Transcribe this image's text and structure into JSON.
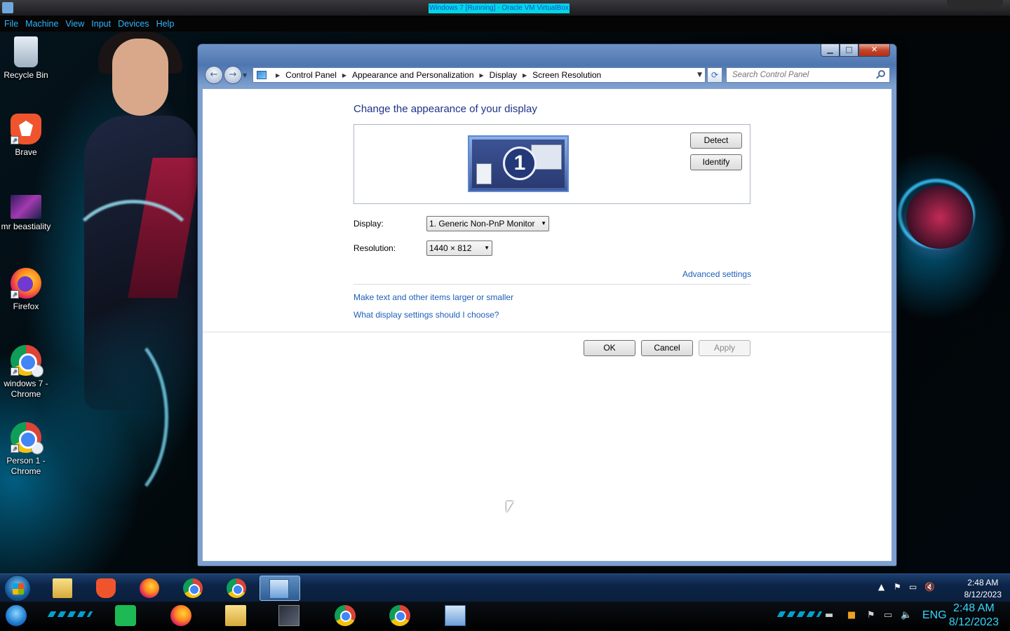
{
  "vbox": {
    "title": "Windows 7 [Running] - Oracle VM VirtualBox",
    "menu": [
      "File",
      "Machine",
      "View",
      "Input",
      "Devices",
      "Help"
    ]
  },
  "desktop_icons": [
    {
      "label": "Recycle Bin",
      "icon": "recycle-bin-icon"
    },
    {
      "label": "Brave",
      "icon": "brave-icon"
    },
    {
      "label": "mr beastiality",
      "icon": "image-file-icon"
    },
    {
      "label": "Firefox",
      "icon": "firefox-icon"
    },
    {
      "label": "windows 7 - Chrome",
      "icon": "chrome-profile-icon"
    },
    {
      "label": "Person 1 - Chrome",
      "icon": "chrome-profile-icon"
    }
  ],
  "window": {
    "breadcrumbs": [
      "Control Panel",
      "Appearance and Personalization",
      "Display",
      "Screen Resolution"
    ],
    "search_placeholder": "Search Control Panel",
    "heading": "Change the appearance of your display",
    "monitor_number": "1",
    "detect_label": "Detect",
    "identify_label": "Identify",
    "display_label": "Display:",
    "display_value": "1. Generic Non-PnP Monitor",
    "resolution_label": "Resolution:",
    "resolution_value": "1440 × 812",
    "advanced_link": "Advanced settings",
    "link_text_size": "Make text and other items larger or smaller",
    "link_help": "What display settings should I choose?",
    "ok_label": "OK",
    "cancel_label": "Cancel",
    "apply_label": "Apply"
  },
  "guest_taskbar": {
    "items": [
      "windows-explorer-icon",
      "brave-icon",
      "firefox-icon",
      "chrome-icon",
      "chrome-profile-icon",
      "control-panel-icon"
    ],
    "clock_time": "2:48 AM",
    "clock_date": "8/12/2023"
  },
  "host_taskbar": {
    "lang": "ENG",
    "clock_time": "2:48 AM",
    "clock_date": "8/12/2023"
  },
  "colors": {
    "vbox_title_bg": "#00d7e8",
    "menu_text": "#2fb4ff",
    "heading": "#1e3287",
    "link": "#1d5fb8",
    "host_clock": "#33d6ff"
  }
}
